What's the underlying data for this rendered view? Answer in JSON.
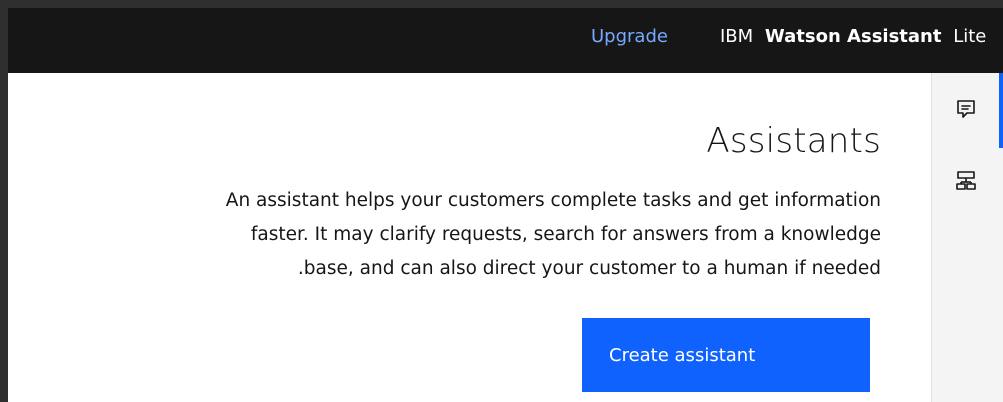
{
  "header": {
    "upgrade_label": "Upgrade",
    "brand_prefix": "IBM",
    "brand_name": "Watson Assistant",
    "brand_suffix": "Lite"
  },
  "main": {
    "title": "Assistants",
    "description_lines": [
      "An assistant helps your customers complete tasks and get information",
      "faster. It may clarify requests, search for answers from a knowledge",
      ".base, and can also direct your customer to a human if needed"
    ],
    "create_button_label": "Create assistant"
  },
  "rail": {
    "icons": [
      "chat-icon",
      "skills-icon"
    ]
  },
  "colors": {
    "header_bg": "#161616",
    "link": "#78a9ff",
    "primary": "#0f62fe",
    "rail_bg": "#f4f4f4",
    "text": "#161616"
  }
}
